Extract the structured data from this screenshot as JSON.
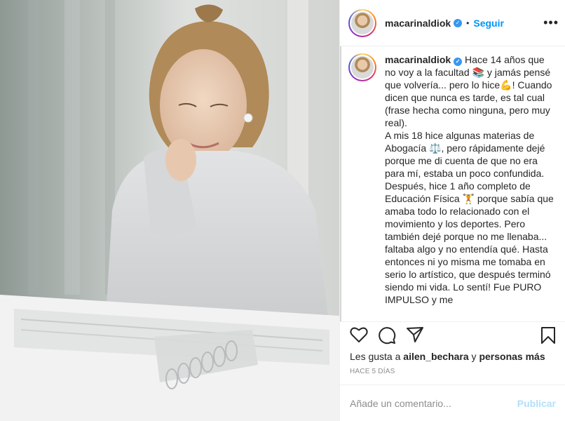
{
  "post": {
    "username": "macarinaldiok",
    "dot": "•",
    "follow_label": "Seguir",
    "more_glyph": "•••",
    "verified_glyph": "✓"
  },
  "caption": {
    "username": "macarinaldiok",
    "text": "Hace 14 años que no voy a la facultad 📚 y jamás pensé que volvería... pero lo hice💪! Cuando dicen que nunca es tarde, es tal cual (frase hecha como ninguna, pero muy real).\nA mis 18 hice algunas materias de Abogacía ⚖️, pero rápidamente dejé porque me di cuenta de que no era para mí, estaba un poco confundida. Después, hice 1 año completo de Educación Física 🏋️ porque sabía que amaba todo lo relacionado con el movimiento y los deportes. Pero también dejé porque no me llenaba... faltaba algo y no entendía qué. Hasta entonces ni yo misma me tomaba en serio lo artístico, que después terminó siendo mi vida. Lo sentí! Fue PURO IMPULSO y me"
  },
  "actions": {
    "icons": [
      "heart-icon",
      "comment-icon",
      "share-icon",
      "bookmark-icon"
    ]
  },
  "likes": {
    "prefix": "Les gusta a ",
    "user": "ailen_bechara",
    "middle": " y ",
    "others": "personas más"
  },
  "timestamp": "HACE 5 DÍAS",
  "comment": {
    "placeholder": "Añade un comentario...",
    "publish_label": "Publicar"
  },
  "colors": {
    "accent": "#0095f6",
    "publish_disabled": "#b2dffc",
    "verified": "#3897f0",
    "muted": "#8e8e8e"
  }
}
